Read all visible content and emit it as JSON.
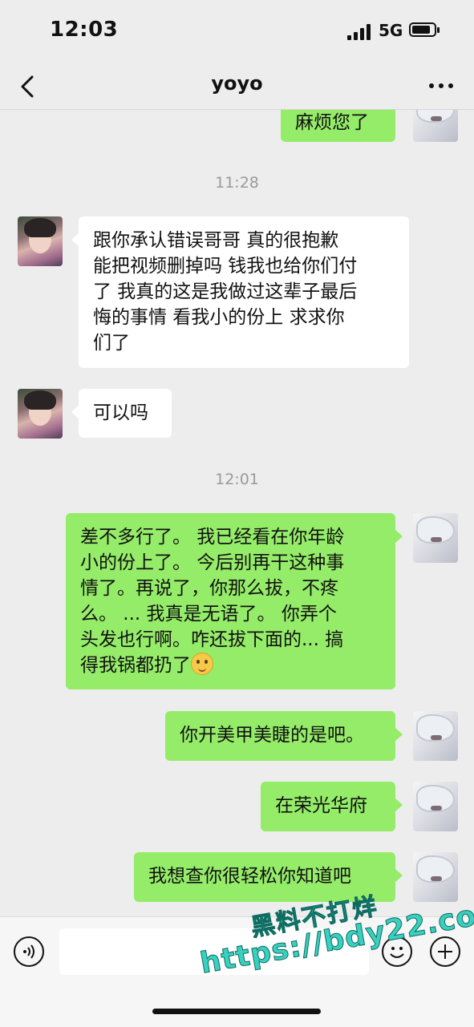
{
  "status_bar": {
    "time": "12:03",
    "network": "5G"
  },
  "nav": {
    "title": "yoyo"
  },
  "watermark": {
    "line1": "黑料不打烊",
    "line2": "https://bdy22.co"
  },
  "messages": [
    {
      "type": "out",
      "lines": [
        "麻烦您了"
      ]
    },
    {
      "type": "timestamp",
      "text": "11:28"
    },
    {
      "type": "in",
      "lines": [
        "跟你承认错误哥哥 真的很抱歉",
        "能把视频删掉吗 钱我也给你们付",
        "了 我真的这是我做过这辈子最后",
        "悔的事情 看我小的份上 求求你",
        "们了"
      ]
    },
    {
      "type": "in",
      "lines": [
        "可以吗"
      ]
    },
    {
      "type": "timestamp",
      "text": "12:01"
    },
    {
      "type": "out",
      "lines": [
        "差不多行了。 我已经看在你年龄",
        "小的份上了。 今后别再干这种事",
        "情了。再说了，你那么拔，不疼",
        "么。 ... 我真是无语了。 你弄个",
        "头发也行啊。咋还拔下面的... 搞",
        "得我锅都扔了"
      ],
      "emoji": "flushed-emoji"
    },
    {
      "type": "out",
      "lines": [
        "你开美甲美睫的是吧。"
      ]
    },
    {
      "type": "out",
      "lines": [
        "在荣光华府"
      ]
    },
    {
      "type": "out",
      "lines": [
        "我想查你很轻松你知道吧"
      ]
    }
  ],
  "icons": {
    "back": "chevron-left-icon",
    "more": "more-dots-icon",
    "voice": "voice-icon",
    "emoji": "emoji-icon",
    "add": "plus-icon"
  },
  "colors": {
    "background": "#ededed",
    "outgoing_bubble": "#95ec69",
    "incoming_bubble": "#ffffff"
  }
}
